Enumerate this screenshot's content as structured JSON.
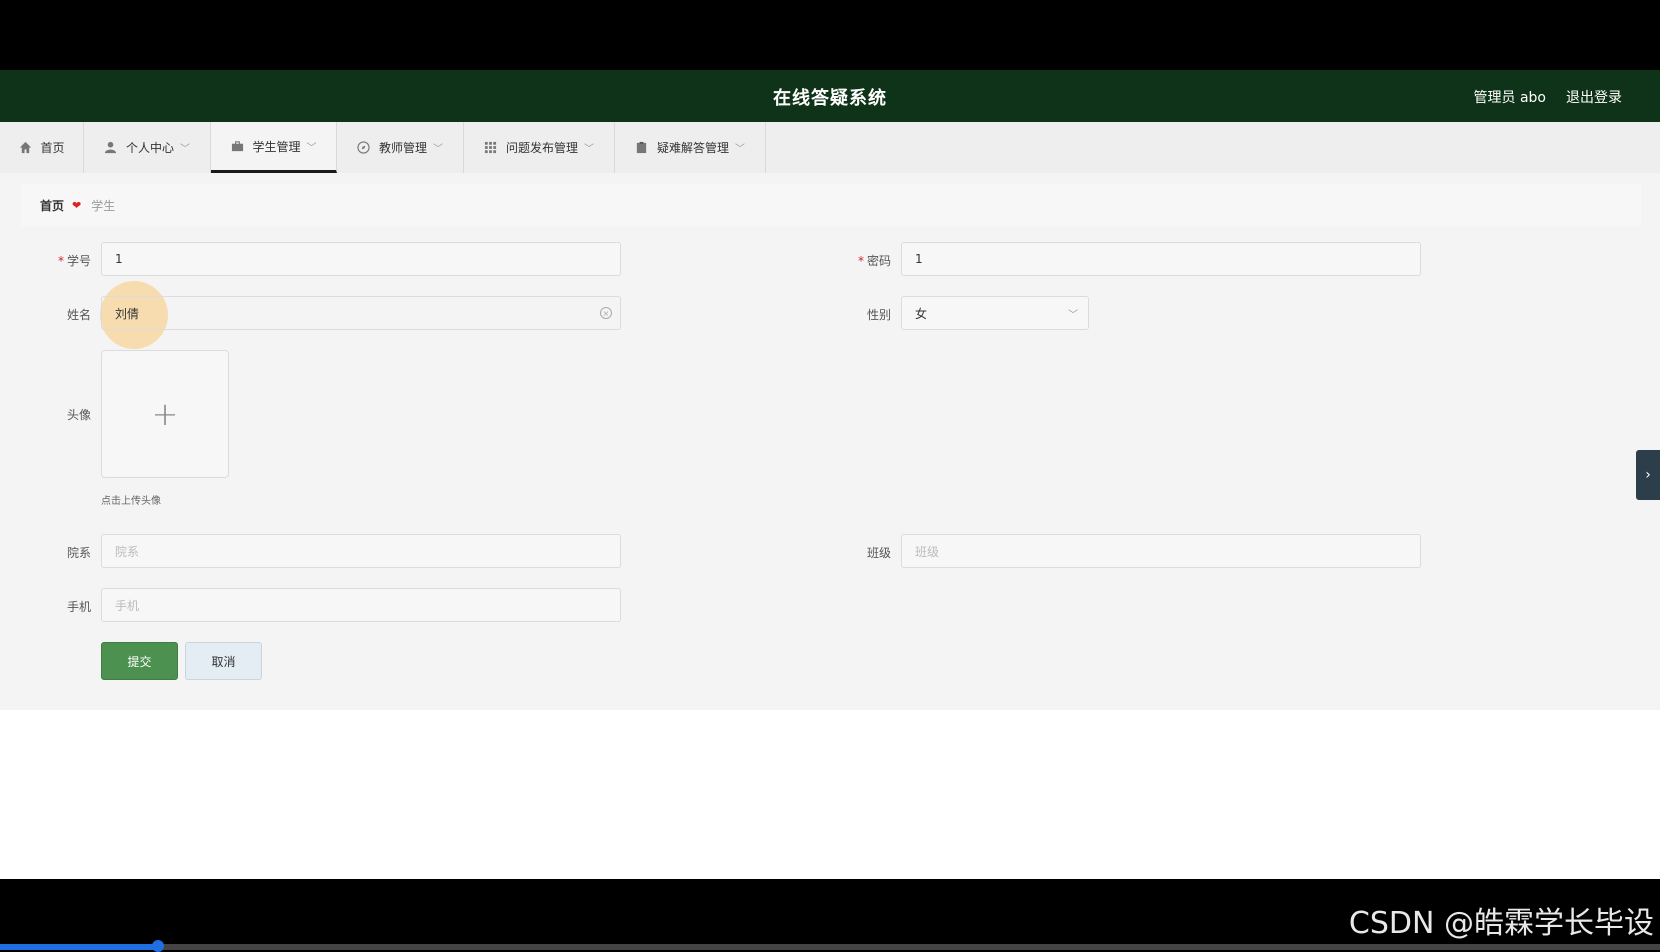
{
  "header": {
    "title": "在线答疑系统",
    "user": "管理员 abo",
    "logout": "退出登录"
  },
  "nav": [
    {
      "label": "首页",
      "icon": "home-icon",
      "chevron": false
    },
    {
      "label": "个人中心",
      "icon": "user-icon",
      "chevron": true
    },
    {
      "label": "学生管理",
      "icon": "briefcase-icon",
      "chevron": true,
      "active": true
    },
    {
      "label": "教师管理",
      "icon": "compass-icon",
      "chevron": true
    },
    {
      "label": "问题发布管理",
      "icon": "grid-icon",
      "chevron": true
    },
    {
      "label": "疑难解答管理",
      "icon": "clipboard-icon",
      "chevron": true
    }
  ],
  "breadcrumb": {
    "home": "首页",
    "current": "学生"
  },
  "form": {
    "student_id": {
      "label": "学号",
      "value": "1",
      "required": true
    },
    "password": {
      "label": "密码",
      "value": "1",
      "required": true
    },
    "name": {
      "label": "姓名",
      "value": "刘倩"
    },
    "gender": {
      "label": "性别",
      "value": "女"
    },
    "avatar": {
      "label": "头像",
      "hint": "点击上传头像"
    },
    "department": {
      "label": "院系",
      "placeholder": "院系"
    },
    "class": {
      "label": "班级",
      "placeholder": "班级"
    },
    "phone": {
      "label": "手机",
      "placeholder": "手机"
    },
    "submit": "提交",
    "cancel": "取消"
  },
  "watermark": "CSDN @皓霖学长毕设",
  "video_progress": 0.095,
  "colors": {
    "header_bg": "#0e3318",
    "primary_button": "#4c9150",
    "required_mark": "#e02020"
  }
}
